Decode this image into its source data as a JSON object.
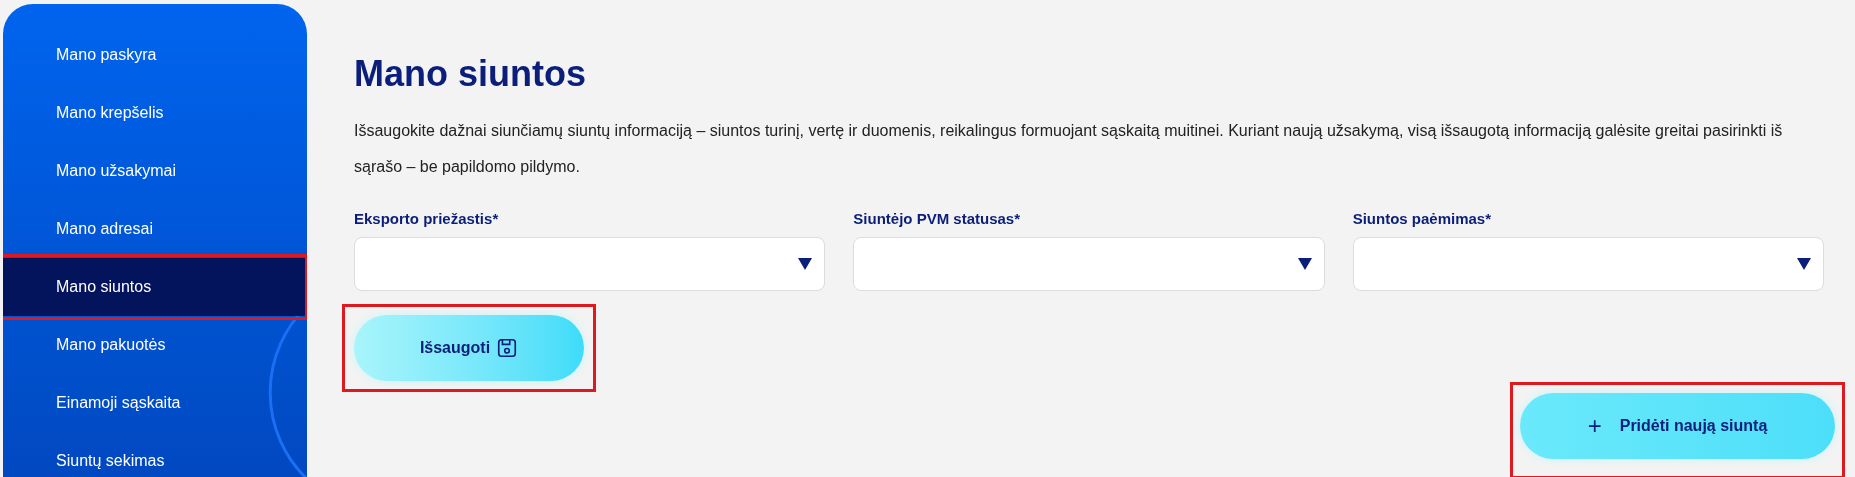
{
  "sidebar": {
    "items": [
      {
        "label": "Mano paskyra",
        "selected": false,
        "highlighted": false
      },
      {
        "label": "Mano krepšelis",
        "selected": false,
        "highlighted": false
      },
      {
        "label": "Mano užsakymai",
        "selected": false,
        "highlighted": false
      },
      {
        "label": "Mano adresai",
        "selected": false,
        "highlighted": false
      },
      {
        "label": "Mano siuntos",
        "selected": true,
        "highlighted": true
      },
      {
        "label": "Mano pakuotės",
        "selected": false,
        "highlighted": false
      },
      {
        "label": "Einamoji sąskaita",
        "selected": false,
        "highlighted": false
      },
      {
        "label": "Siuntų sekimas",
        "selected": false,
        "highlighted": false
      }
    ]
  },
  "page": {
    "title": "Mano siuntos",
    "description": "Išsaugokite dažnai siunčiamų siuntų informaciją – siuntos turinį, vertę ir duomenis, reikalingus formuojant sąskaitą muitinei. Kuriant naują užsakymą, visą išsaugotą informaciją galėsite greitai pasirinkti iš sąrašo – be papildomo pildymo.",
    "fields": [
      {
        "label": "Eksporto priežastis*"
      },
      {
        "label": "Siuntėjo PVM statusas*"
      },
      {
        "label": "Siuntos paėmimas*"
      }
    ],
    "save_button": {
      "label": "Išsaugoti",
      "highlighted": true
    },
    "add_button": {
      "icon": "+",
      "label": "Pridėti naują siuntą",
      "highlighted": true
    }
  }
}
